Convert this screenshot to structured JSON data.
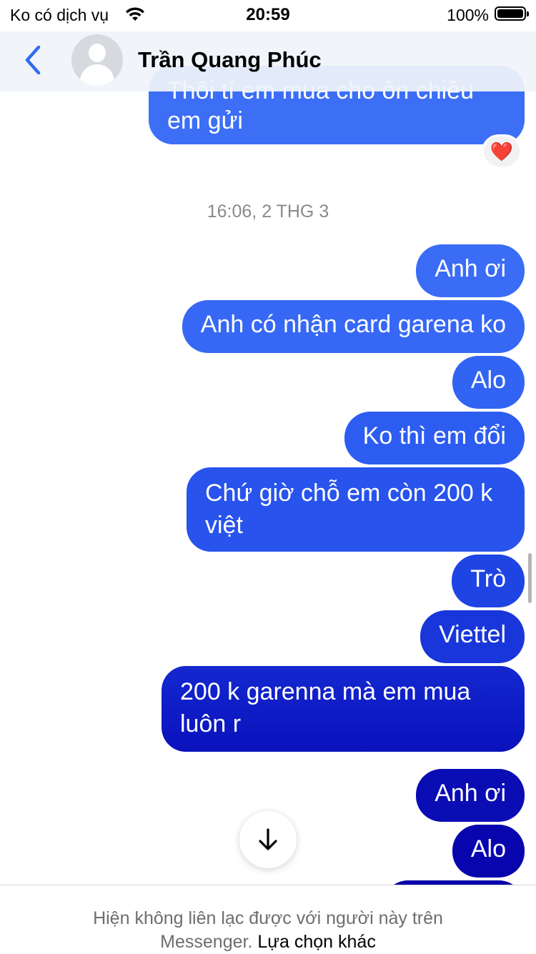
{
  "status_bar": {
    "carrier": "Ko có dịch vụ",
    "time": "20:59",
    "battery": "100%"
  },
  "header": {
    "contact_name": "Trần Quang Phúc"
  },
  "messages_top": {
    "partial_line": "Thôi tí em mua cho ôn chiều",
    "line2": "em gửi",
    "reaction": "❤️"
  },
  "timestamp": "16:06, 2 THG 3",
  "messages": [
    "Anh ơi",
    "Anh có nhận card garena ko",
    "Alo",
    "Ko thì em đổi",
    "Chứ giờ chỗ em còn 200 k việt",
    "Trò",
    "Viettel",
    "200 k garenna mà em mua luôn r",
    "Anh ơi",
    "Alo"
  ],
  "footer": {
    "text": "Hiện không liên lạc được với người này trên Messenger.",
    "link": "Lựa chọn khác"
  },
  "colors": {
    "bubble_top": "#3a6cf6",
    "bubble_bottom": "#0a00a8",
    "accent": "#2f6fe6"
  }
}
